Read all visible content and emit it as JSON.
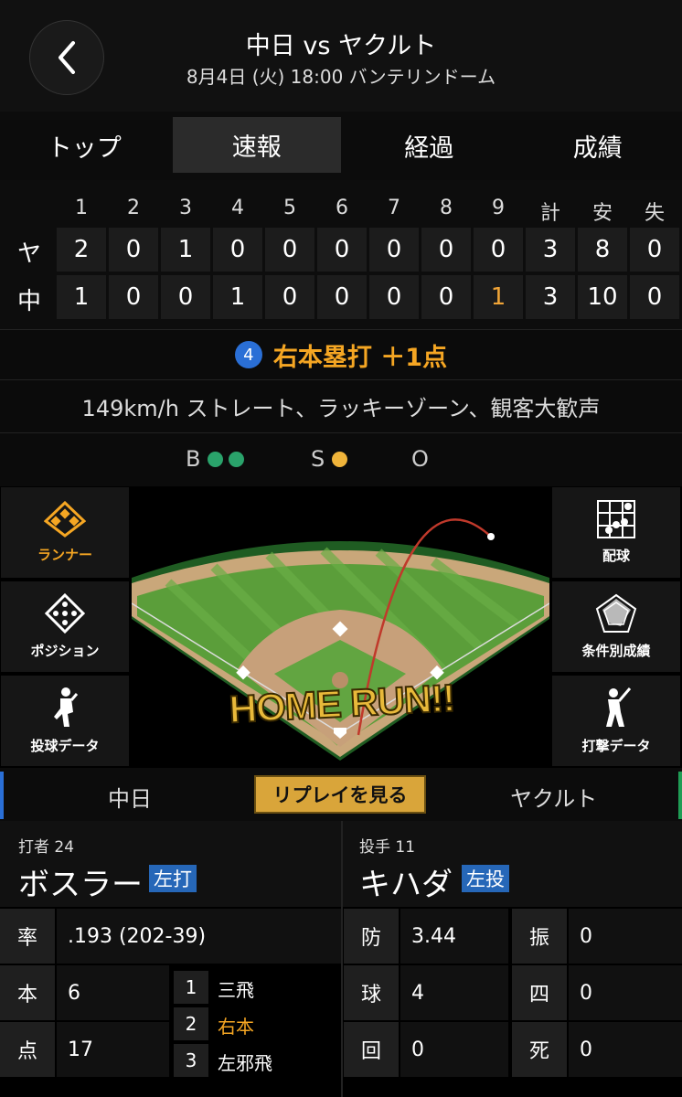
{
  "header": {
    "title": "中日 vs ヤクルト",
    "subtitle": "8月4日 (火) 18:00 バンテリンドーム"
  },
  "tabs": [
    {
      "label": "トップ",
      "active": false
    },
    {
      "label": "速報",
      "active": true
    },
    {
      "label": "経過",
      "active": false
    },
    {
      "label": "成績",
      "active": false
    }
  ],
  "scoreboard": {
    "headers": [
      "1",
      "2",
      "3",
      "4",
      "5",
      "6",
      "7",
      "8",
      "9",
      "計",
      "安",
      "失"
    ],
    "rows": [
      {
        "team": "ヤ",
        "cells": [
          "2",
          "0",
          "1",
          "0",
          "0",
          "0",
          "0",
          "0",
          "0",
          "3",
          "8",
          "0"
        ]
      },
      {
        "team": "中",
        "cells": [
          "1",
          "0",
          "0",
          "1",
          "0",
          "0",
          "0",
          "0",
          "1",
          "3",
          "10",
          "0"
        ]
      }
    ],
    "highlight_color": "#f0a437"
  },
  "play": {
    "number": "4",
    "result": "右本塁打 ＋1点",
    "description": "149km/h ストレート、ラッキーゾーン、観客大歓声"
  },
  "count": {
    "ball_label": "B",
    "balls": 2,
    "strike_label": "S",
    "strikes": 1,
    "out_label": "O",
    "outs": 0,
    "ball_color": "#2aa36b",
    "strike_color": "#f0b43a"
  },
  "side_left": [
    {
      "label": "ランナー",
      "icon": "diamond-runner-icon",
      "active": true
    },
    {
      "label": "ポジション",
      "icon": "position-icon",
      "active": false
    },
    {
      "label": "投球データ",
      "icon": "pitcher-icon",
      "active": false
    }
  ],
  "side_right": [
    {
      "label": "配球",
      "icon": "pitch-grid-icon"
    },
    {
      "label": "条件別成績",
      "icon": "radar-icon"
    },
    {
      "label": "打撃データ",
      "icon": "batter-icon"
    }
  ],
  "field": {
    "banner": "HOME RUN!!"
  },
  "team_bar": {
    "left": "中日",
    "replay": "リプレイを見る",
    "right": "ヤクルト"
  },
  "batter": {
    "role": "打者 24",
    "name": "ボスラー",
    "tag": "左打",
    "stats": [
      {
        "label": "率",
        "value": ".193 (202-39)"
      },
      {
        "label": "本",
        "value": "6"
      },
      {
        "label": "点",
        "value": "17"
      }
    ],
    "at_bats": [
      {
        "num": "1",
        "result": "三飛",
        "highlight": false
      },
      {
        "num": "2",
        "result": "右本",
        "highlight": true
      },
      {
        "num": "3",
        "result": "左邪飛",
        "highlight": false
      }
    ]
  },
  "pitcher": {
    "role": "投手 11",
    "name": "キハダ",
    "tag": "左投",
    "stats": [
      {
        "label": "防",
        "value": "3.44",
        "label2": "振",
        "value2": "0"
      },
      {
        "label": "球",
        "value": "4",
        "label2": "四",
        "value2": "0"
      },
      {
        "label": "回",
        "value": "0",
        "label2": "死",
        "value2": "0"
      }
    ]
  }
}
